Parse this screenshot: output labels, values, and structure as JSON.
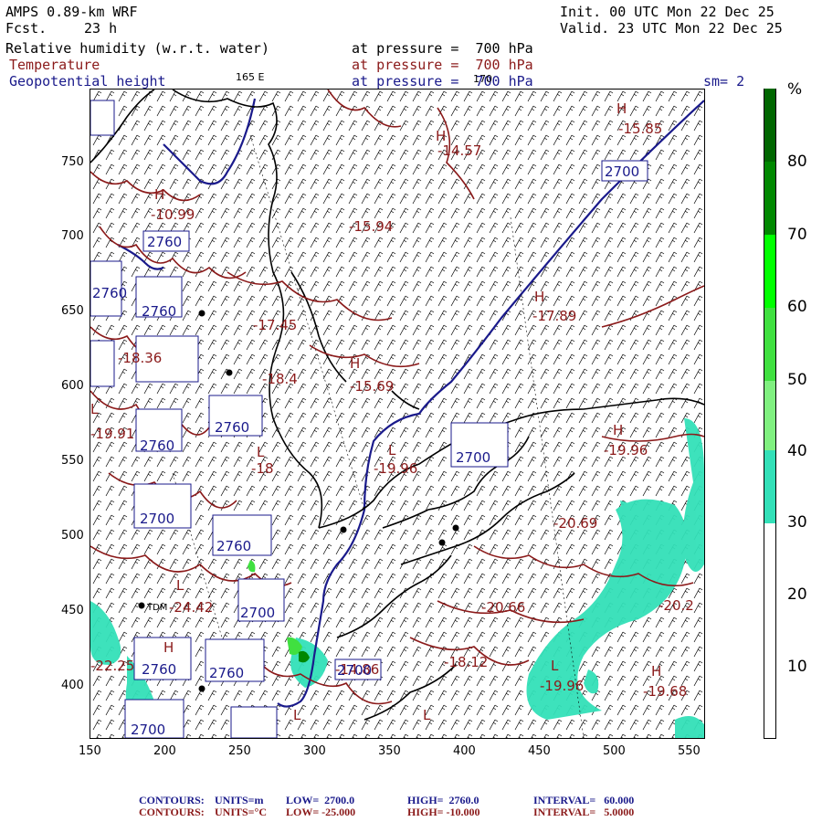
{
  "header": {
    "model": "AMPS 0.89-km WRF",
    "fcst_label": "Fcst.",
    "fcst_value": "23 h",
    "init": "Init. 00 UTC Mon 22 Dec 25",
    "valid": "Valid. 23 UTC Mon 22 Dec 25",
    "field1": "Relative humidity (w.r.t. water)",
    "field2": "Temperature",
    "field3": "Geopotential height",
    "pressure1": "at pressure =  700 hPa",
    "pressure2": "at pressure =  700 hPa",
    "pressure3": "at pressure =  700 hPa",
    "lon_165": "165 E",
    "lon_170": "170",
    "sm": "sm= 2"
  },
  "colors": {
    "rh_30_40": "#33e0b8",
    "rh_40_50": "#80f080",
    "rh_50_60": "#40e040",
    "rh_60_70": "#00ff00",
    "rh_70_80": "#008800",
    "rh_80_90": "#006600",
    "temperature": "#8b1a1a",
    "height": "#1a1a8b",
    "coast": "#000000"
  },
  "colorbar": {
    "unit": "%",
    "ticks": [
      "80",
      "70",
      "60",
      "50",
      "40",
      "30",
      "20",
      "10"
    ]
  },
  "axes": {
    "x_ticks": [
      "150",
      "200",
      "250",
      "300",
      "350",
      "400",
      "450",
      "500",
      "550"
    ],
    "y_ticks": [
      "750",
      "700",
      "650",
      "600",
      "550",
      "500",
      "450",
      "400"
    ]
  },
  "map_labels": {
    "height_boxes": [
      "2700",
      "2760",
      "2760",
      "2700",
      "2760",
      "2700",
      "2700",
      "2760",
      "2760",
      "2700",
      "2760",
      "2760",
      "2760",
      "2700"
    ],
    "temps": [
      "-15.85",
      "-14.57",
      "-10.99",
      "-15.94",
      "-17.89",
      "-17.45",
      "-18.36",
      "-18.4",
      "-15.69",
      "-19.96",
      "-19.91",
      "-18",
      "-19.96",
      "-20.69",
      "-20.66",
      "-18.12",
      "-19.96",
      "-19.68",
      "-20.2",
      "-24.42",
      "-22.25",
      "-14.86"
    ],
    "highs_lows": [
      "H",
      "H",
      "H",
      "H",
      "H",
      "L",
      "L",
      "L",
      "H",
      "L",
      "H",
      "L",
      "L",
      "H",
      "L"
    ],
    "station": "TDM"
  },
  "footer": {
    "line1": {
      "contours": "CONTOURS:",
      "units": "UNITS=m",
      "low": "LOW=  2700.0",
      "high": "HIGH=  2760.0",
      "interval": "INTERVAL=   60.000"
    },
    "line2": {
      "contours": "CONTOURS:",
      "units": "UNITS=°C",
      "low": "LOW= -25.000",
      "high": "HIGH= -10.000",
      "interval": "INTERVAL=   5.0000"
    }
  }
}
